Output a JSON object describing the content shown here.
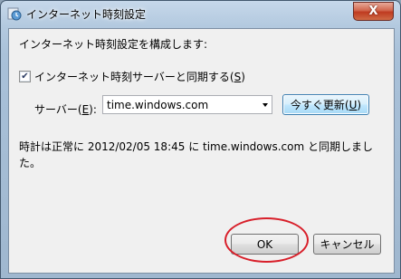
{
  "window": {
    "title": "インターネット時刻設定",
    "close_glyph": "X"
  },
  "dialog": {
    "heading": "インターネット時刻設定を構成します:",
    "sync_checkbox": {
      "checked": true,
      "label_prefix": "インターネット時刻サーバーと同期する(",
      "label_accel": "S",
      "label_suffix": ")"
    },
    "server": {
      "label_prefix": "サーバー(",
      "label_accel": "E",
      "label_suffix": "):",
      "value": "time.windows.com"
    },
    "update_button": {
      "label_prefix": "今すぐ更新(",
      "label_accel": "U",
      "label_suffix": ")"
    },
    "status_text": "時計は正常に 2012/02/05 18:45 に time.windows.com と同期しました。",
    "ok_label": "OK",
    "cancel_label": "キャンセル"
  },
  "colors": {
    "annotation_circle": "#d81f2a",
    "close_button": "#c94b30"
  },
  "icons": {
    "app": "globe-clock-icon",
    "close": "close-icon",
    "dropdown": "chevron-down-icon"
  }
}
